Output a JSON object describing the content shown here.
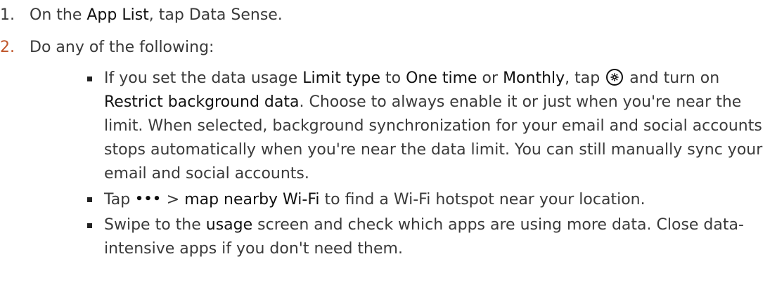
{
  "steps": [
    {
      "number": "1.",
      "parts": [
        "On the ",
        "App List",
        ", tap Data Sense."
      ]
    },
    {
      "number": "2.",
      "text": "Do any of the following:"
    }
  ],
  "bullets": [
    {
      "parts": [
        "If you set the data usage ",
        "Limit type",
        " to ",
        "One time",
        " or ",
        "Monthly",
        ", tap ",
        " and turn on ",
        "Restrict background data",
        ". Choose to always enable it or just when you're near the limit. When selected, background synchronization for your email and social accounts stops automatically when you're near the data limit. You can still manually sync your email and social accounts."
      ],
      "icon": "settings-gear-icon"
    },
    {
      "parts": [
        "Tap ",
        "•••",
        " > ",
        "map nearby Wi-Fi",
        " to find a Wi-Fi hotspot near your location."
      ],
      "icon": "more-options-icon"
    },
    {
      "parts": [
        "Swipe to the ",
        "usage",
        " screen and check which apps are using more data. Close data-intensive apps if you don't need them."
      ]
    }
  ],
  "colors": {
    "step_number_accent": "#c0562a",
    "body_text": "#3a3a3a",
    "emphasis_text": "#111111"
  }
}
